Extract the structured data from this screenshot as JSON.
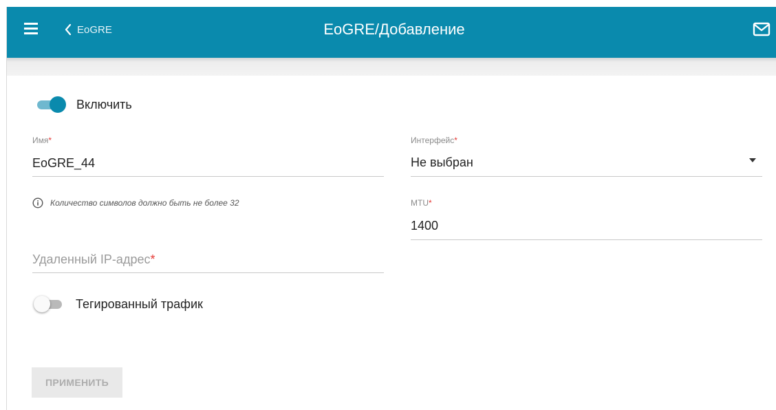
{
  "header": {
    "back_label": "EoGRE",
    "title": "EoGRE/Добавление",
    "menu_icon": "hamburger-menu-icon",
    "back_icon": "chevron-left-icon",
    "mail_icon": "envelope-icon",
    "bar_color": "#0a8aad"
  },
  "form": {
    "enable": {
      "label": "Включить",
      "checked": true
    },
    "name": {
      "label": "Имя",
      "required_mark": "*",
      "value": "EoGRE_44",
      "hint": "Количество символов должно быть не более 32",
      "hint_icon": "info-circle-icon"
    },
    "interface": {
      "label": "Интерфейс",
      "required_mark": "*",
      "selected": "Не выбран"
    },
    "mtu": {
      "label": "MTU",
      "required_mark": "*",
      "value": "1400"
    },
    "remote_ip": {
      "label": "Удаленный IP-адрес",
      "required_mark": "*",
      "value": ""
    },
    "tagged_traffic": {
      "label": "Тегированный трафик",
      "checked": false
    },
    "apply_label": "ПРИМЕНИТЬ"
  },
  "colors": {
    "accent": "#0a8aad",
    "required": "#e53935"
  }
}
